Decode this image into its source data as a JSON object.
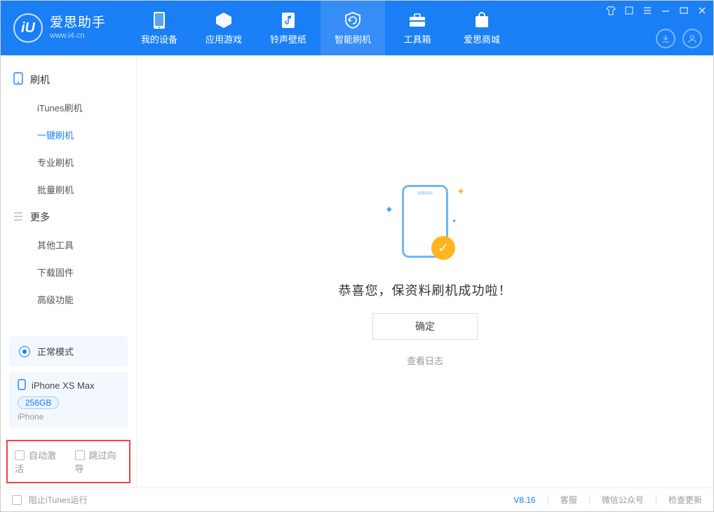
{
  "app": {
    "title": "爱思助手",
    "subtitle": "www.i4.cn"
  },
  "nav": {
    "items": [
      {
        "label": "我的设备"
      },
      {
        "label": "应用游戏"
      },
      {
        "label": "铃声壁纸"
      },
      {
        "label": "智能刷机"
      },
      {
        "label": "工具箱"
      },
      {
        "label": "爱思商城"
      }
    ]
  },
  "sidebar": {
    "section_flash": "刷机",
    "items_flash": [
      {
        "label": "iTunes刷机"
      },
      {
        "label": "一键刷机"
      },
      {
        "label": "专业刷机"
      },
      {
        "label": "批量刷机"
      }
    ],
    "section_more": "更多",
    "items_more": [
      {
        "label": "其他工具"
      },
      {
        "label": "下载固件"
      },
      {
        "label": "高级功能"
      }
    ],
    "mode": "正常模式",
    "device": {
      "name": "iPhone XS Max",
      "storage": "256GB",
      "type": "iPhone"
    },
    "opts": {
      "auto_activate": "自动激活",
      "skip_guide": "跳过向导"
    }
  },
  "main": {
    "success_text": "恭喜您，保资料刷机成功啦！",
    "confirm": "确定",
    "view_log": "查看日志"
  },
  "footer": {
    "block_itunes": "阻止iTunes运行",
    "version": "V8.16",
    "link_service": "客服",
    "link_wechat": "微信公众号",
    "link_update": "检查更新"
  }
}
